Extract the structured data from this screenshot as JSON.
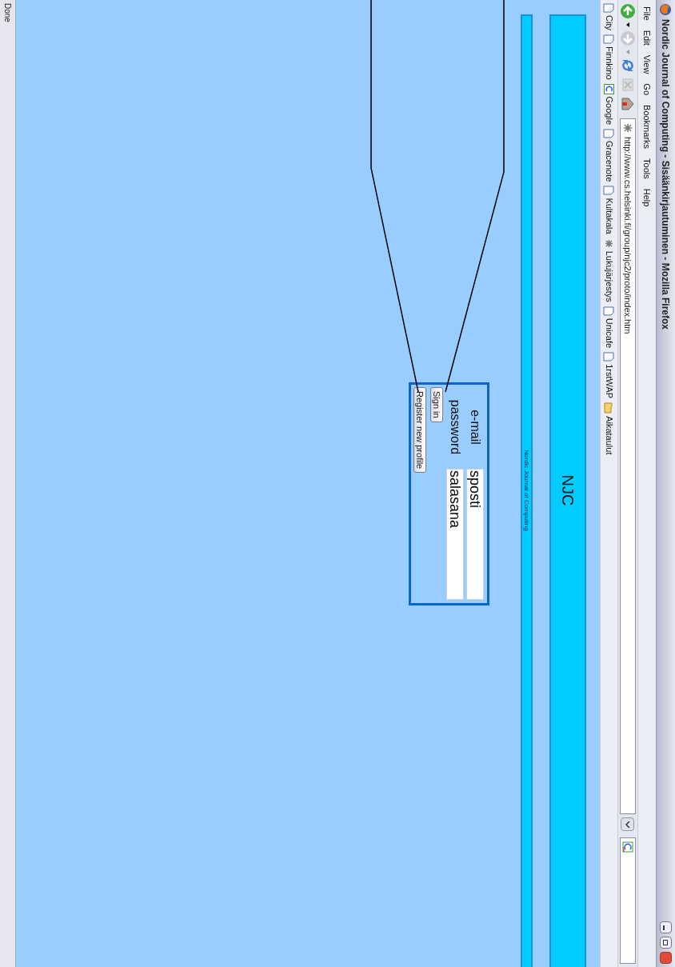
{
  "window": {
    "title": "Nordic Journal of Computing - Sisäänkirjautuminen - Mozilla Firefox"
  },
  "menu": [
    "File",
    "Edit",
    "View",
    "Go",
    "Bookmarks",
    "Tools",
    "Help"
  ],
  "address": {
    "url": "http://www.cs.helsinki.fi/group/njc2/proto/index.htm"
  },
  "bookmarks": [
    {
      "label": "City",
      "kind": "page"
    },
    {
      "label": "Finnkino",
      "kind": "page"
    },
    {
      "label": "Google",
      "kind": "google"
    },
    {
      "label": "Gracenote",
      "kind": "page"
    },
    {
      "label": "Kultakala",
      "kind": "page"
    },
    {
      "label": "Lukujärjestys",
      "kind": "site"
    },
    {
      "label": "Unicafe",
      "kind": "page"
    },
    {
      "label": "1rstWAP",
      "kind": "page"
    },
    {
      "label": "Aikataulut",
      "kind": "folder"
    }
  ],
  "page": {
    "header": "NJC",
    "subtitle": "Nordic Journal of Computing",
    "login": {
      "fields": [
        {
          "label": "e-mail",
          "value": "sposti"
        },
        {
          "label": "password",
          "value": "salasana"
        }
      ],
      "buttons": [
        "Sign in",
        "Register new profile"
      ]
    }
  },
  "status_bar": {
    "text": "Done"
  }
}
